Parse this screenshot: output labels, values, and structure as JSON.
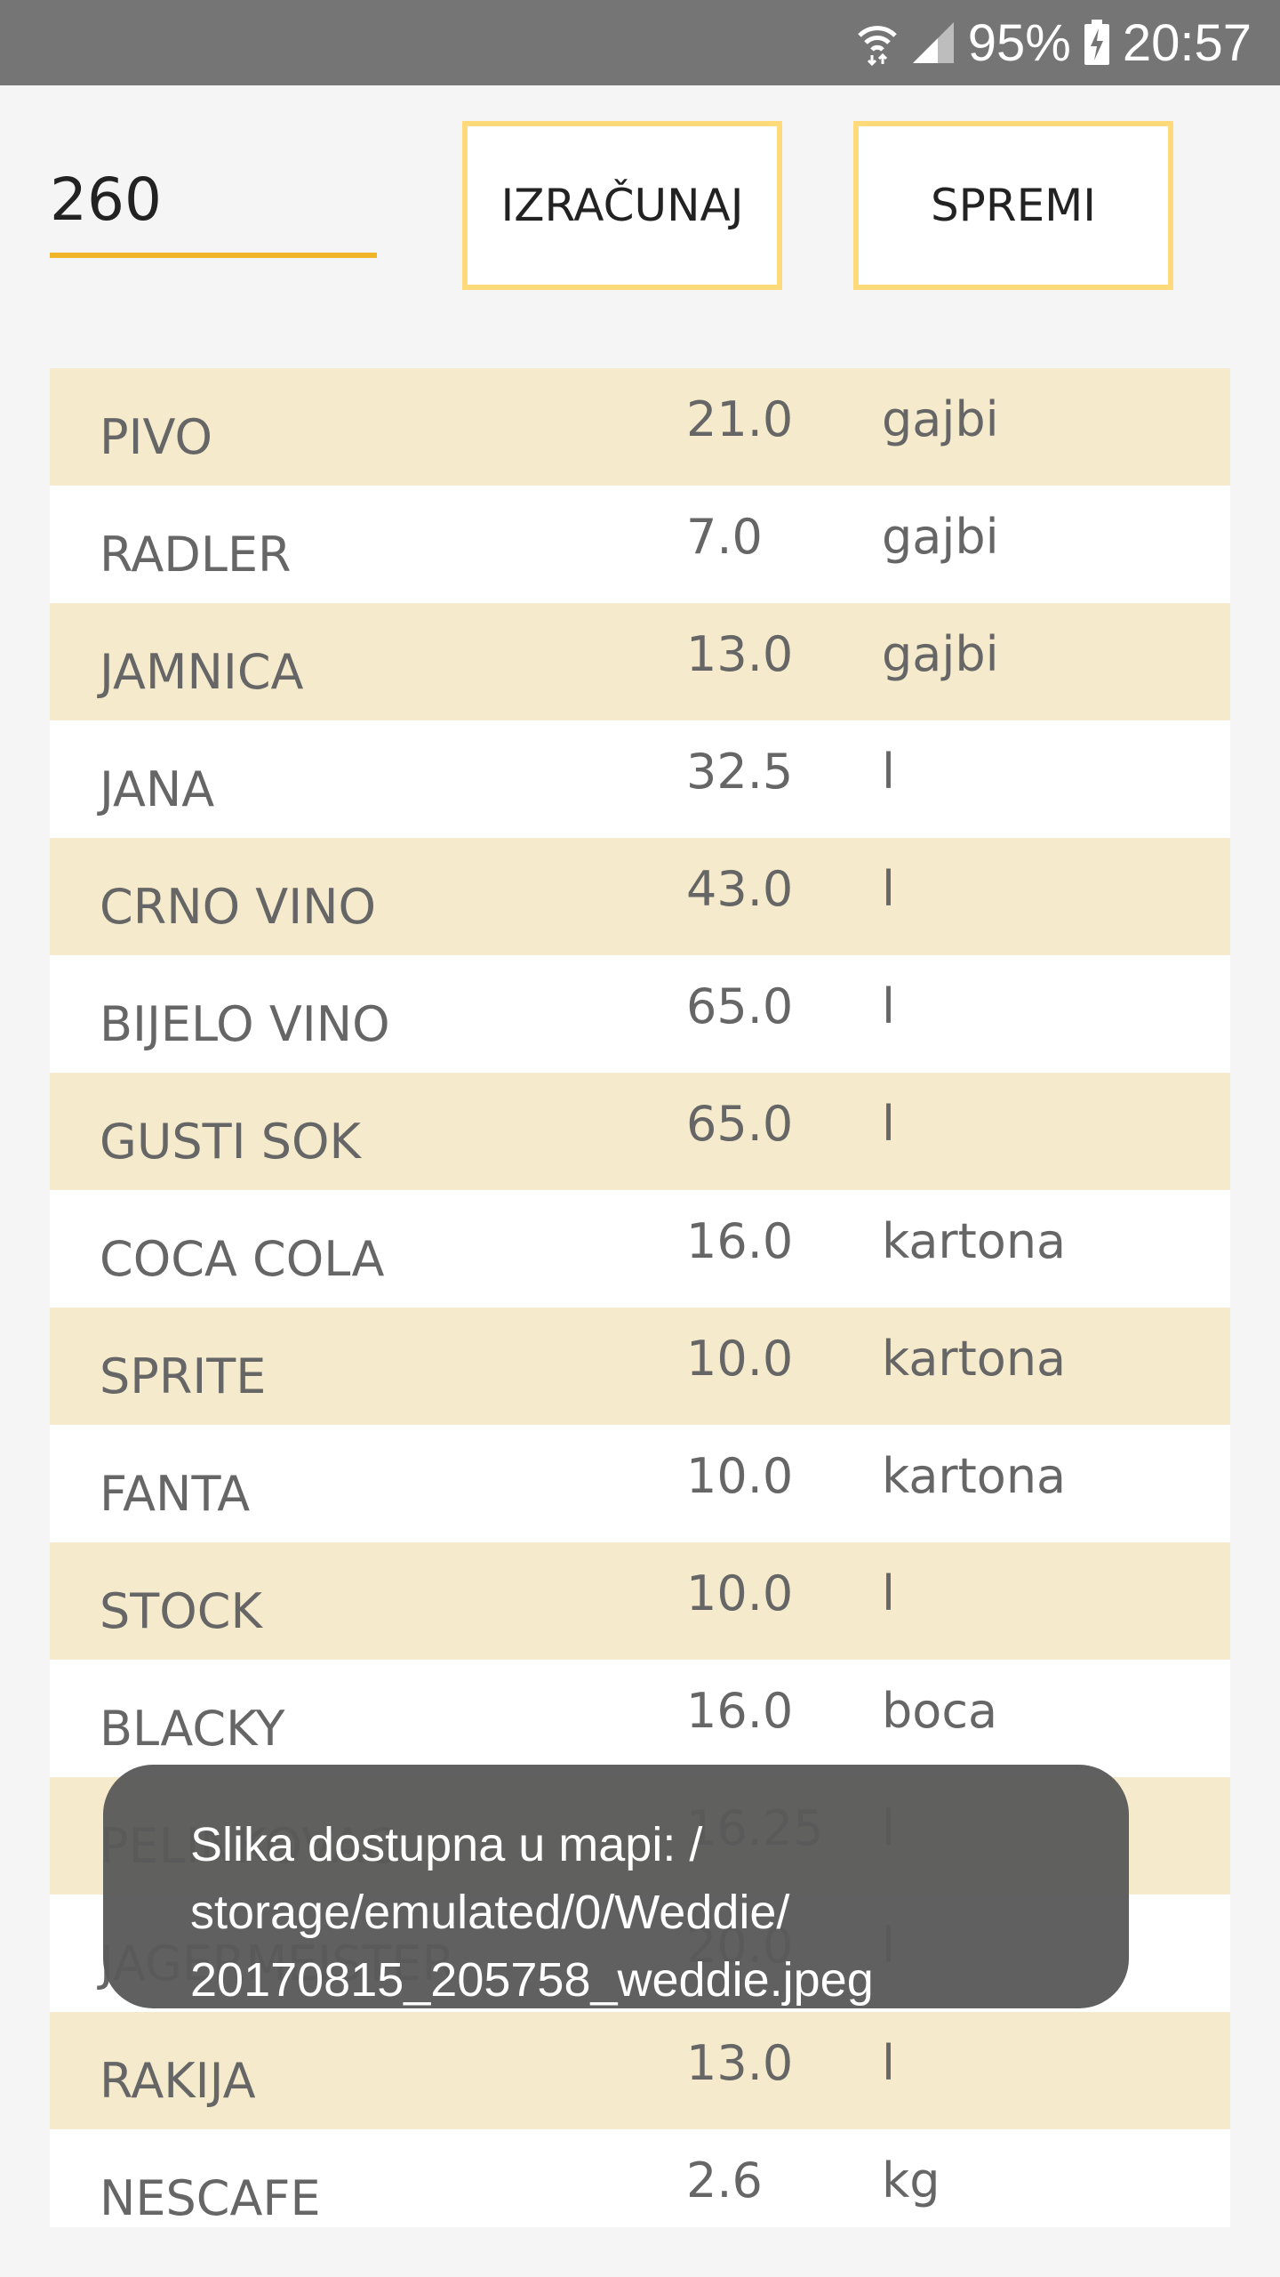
{
  "status_bar": {
    "battery": "95%",
    "time": "20:57",
    "icons": [
      "wifi-icon",
      "cell-signal-icon",
      "battery-charging-icon"
    ]
  },
  "controls": {
    "amount_value": "260",
    "calc_label": "IZRAČUNAJ",
    "save_label": "SPREMI"
  },
  "items": [
    {
      "name": "PIVO",
      "qty": "21.0",
      "unit": "gajbi"
    },
    {
      "name": "RADLER",
      "qty": "7.0",
      "unit": "gajbi"
    },
    {
      "name": "JAMNICA",
      "qty": "13.0",
      "unit": "gajbi"
    },
    {
      "name": "JANA",
      "qty": "32.5",
      "unit": "l"
    },
    {
      "name": "CRNO VINO",
      "qty": "43.0",
      "unit": "l"
    },
    {
      "name": "BIJELO VINO",
      "qty": "65.0",
      "unit": "l"
    },
    {
      "name": "GUSTI SOK",
      "qty": "65.0",
      "unit": "l"
    },
    {
      "name": "COCA COLA",
      "qty": "16.0",
      "unit": "kartona"
    },
    {
      "name": "SPRITE",
      "qty": "10.0",
      "unit": "kartona"
    },
    {
      "name": "FANTA",
      "qty": "10.0",
      "unit": "kartona"
    },
    {
      "name": "STOCK",
      "qty": "10.0",
      "unit": "l"
    },
    {
      "name": "BLACKY",
      "qty": "16.0",
      "unit": "boca"
    },
    {
      "name": "PELINKOVAC",
      "qty": "16.25",
      "unit": "l"
    },
    {
      "name": "JAGERMEISTER",
      "qty": "20.0",
      "unit": "l"
    },
    {
      "name": "RAKIJA",
      "qty": "13.0",
      "unit": "l"
    },
    {
      "name": "NESCAFE",
      "qty": "2.6",
      "unit": "kg"
    }
  ],
  "toast": {
    "line1": "Slika dostupna u mapi: /",
    "line2": "storage/emulated/0/Weddie/",
    "line3": "20170815_205758_weddie.jpeg"
  }
}
